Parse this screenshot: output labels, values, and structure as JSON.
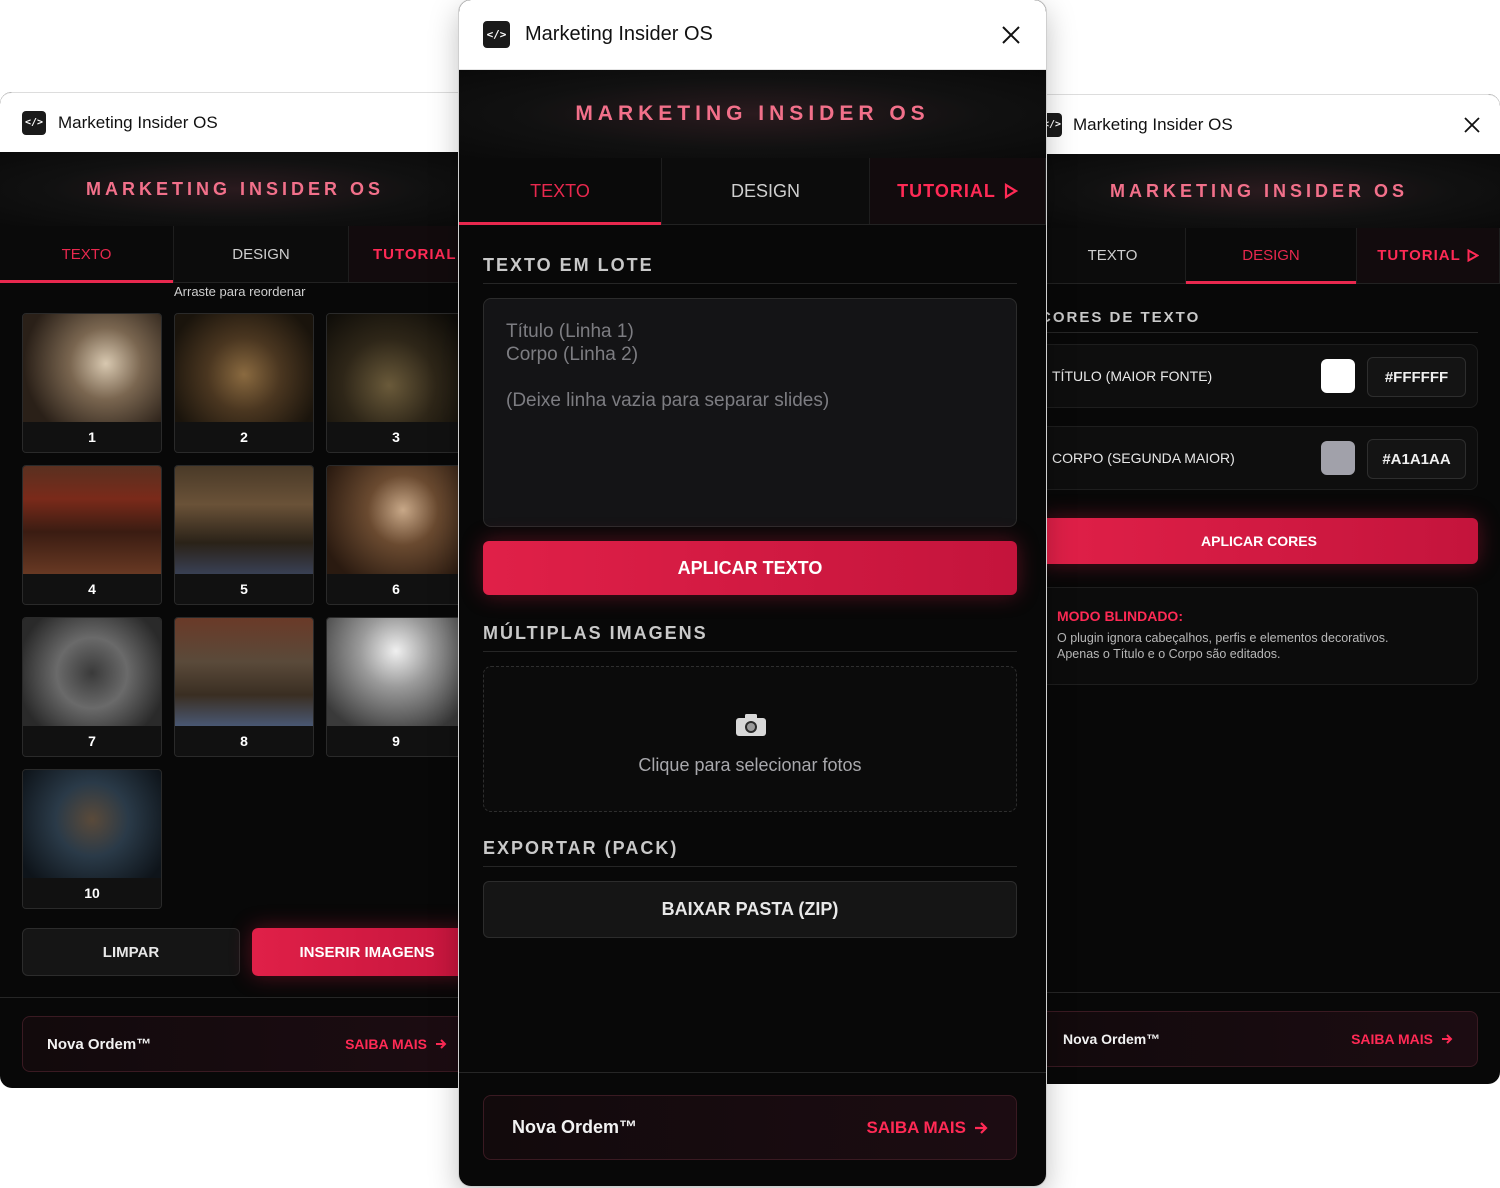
{
  "left_window": {
    "title": "Marketing Insider OS",
    "brand": "MARKETING INSIDER OS",
    "tabs": [
      "TEXTO",
      "DESIGN",
      "TUTORIAL"
    ],
    "hint": "Arraste para reordenar",
    "thumbnails": [
      "1",
      "2",
      "3",
      "4",
      "5",
      "6",
      "7",
      "8",
      "9",
      "10"
    ],
    "clear_label": "LIMPAR",
    "insert_label": "INSERIR IMAGENS",
    "footer": {
      "name": "Nova Ordem™",
      "more": "SAIBA MAIS"
    }
  },
  "center_window": {
    "title": "Marketing Insider OS",
    "brand": "MARKETING INSIDER OS",
    "tabs": [
      "TEXTO",
      "DESIGN",
      "TUTORIAL"
    ],
    "batch_title": "TEXTO EM LOTE",
    "textarea_placeholder": "Título (Linha 1)\nCorpo (Linha 2)\n\n(Deixe linha vazia para separar slides)",
    "apply_text_label": "APLICAR TEXTO",
    "images_title": "MÚLTIPLAS IMAGENS",
    "upload_label": "Clique para selecionar fotos",
    "export_title": "EXPORTAR (PACK)",
    "download_label": "BAIXAR PASTA (ZIP)",
    "footer": {
      "name": "Nova Ordem™",
      "more": "SAIBA MAIS"
    }
  },
  "right_window": {
    "title": "Marketing Insider OS",
    "brand": "MARKETING INSIDER OS",
    "tabs": [
      "TEXTO",
      "DESIGN",
      "TUTORIAL"
    ],
    "colors_title": "CORES DE TEXTO",
    "title_color": {
      "label": "TÍTULO (MAIOR FONTE)",
      "value": "#FFFFFF",
      "swatch": "#FFFFFF"
    },
    "body_color": {
      "label": "CORPO (SEGUNDA MAIOR)",
      "value": "#A1A1AA",
      "swatch": "#A1A1AA"
    },
    "apply_colors_label": "APLICAR CORES",
    "shield": {
      "title": "MODO BLINDADO:",
      "line1": "O plugin ignora cabeçalhos, perfis e elementos decorativos.",
      "line2": "Apenas o Título e o Corpo são editados."
    },
    "footer": {
      "name": "Nova Ordem™",
      "more": "SAIBA MAIS"
    }
  },
  "colors": {
    "accent": "#E8284E",
    "brand_text": "#F2708A",
    "panel_bg": "#080808"
  },
  "icons": {
    "app": "code-brackets-icon",
    "close": "close-icon",
    "play": "play-triangle-icon",
    "arrow": "arrow-right-icon",
    "camera": "camera-icon"
  }
}
